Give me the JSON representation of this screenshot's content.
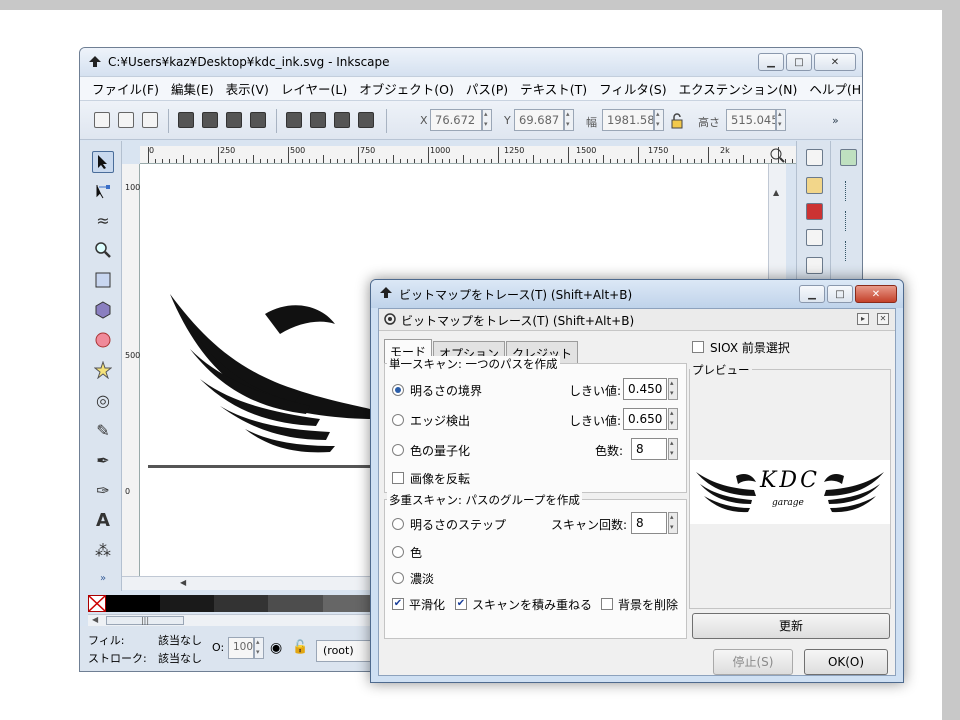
{
  "main_window": {
    "title": "C:¥Users¥kaz¥Desktop¥kdc_ink.svg - Inkscape",
    "menu": [
      "ファイル(F)",
      "編集(E)",
      "表示(V)",
      "レイヤー(L)",
      "オブジェクト(O)",
      "パス(P)",
      "テキスト(T)",
      "フィルタ(S)",
      "エクステンション(N)",
      "ヘルプ(H)"
    ],
    "coords": {
      "x_label": "X",
      "x_value": "76.672",
      "y_label": "Y",
      "y_value": "69.687",
      "w_label": "幅",
      "w_value": "1981.58",
      "h_label": "高さ",
      "h_value": "515.045"
    },
    "overflow": "»",
    "ruler_h": [
      "0",
      "250",
      "500",
      "750",
      "1000",
      "1250",
      "1500",
      "1750",
      "2k"
    ],
    "ruler_v": [
      "1000",
      "500",
      "0"
    ],
    "toolbox_more": "»",
    "status": {
      "fill_label": "フィル:",
      "fill_value": "該当なし",
      "stroke_label": "ストローク:",
      "stroke_value": "該当なし",
      "opacity_label": "O:",
      "opacity_value": "100",
      "layer": "(root)"
    }
  },
  "dialog": {
    "title": "ビットマップをトレース(T) (Shift+Alt+B)",
    "panel_title": "ビットマップをトレース(T) (Shift+Alt+B)",
    "tabs": [
      "モード",
      "オプション",
      "クレジット"
    ],
    "single_scan": {
      "title": "単一スキャン: 一つのパスを作成",
      "options": [
        {
          "label": "明るさの境界",
          "param_label": "しきい値:",
          "value": "0.450",
          "selected": true
        },
        {
          "label": "エッジ検出",
          "param_label": "しきい値:",
          "value": "0.650",
          "selected": false
        },
        {
          "label": "色の量子化",
          "param_label": "色数:",
          "value": "8",
          "selected": false
        }
      ],
      "invert_label": "画像を反転"
    },
    "multi_scan": {
      "title": "多重スキャン: パスのグループを作成",
      "options": [
        {
          "label": "明るさのステップ",
          "param_label": "スキャン回数:",
          "value": "8",
          "selected": false
        },
        {
          "label": "色",
          "selected": false
        },
        {
          "label": "濃淡",
          "selected": false
        }
      ],
      "smooth_label": "平滑化",
      "stack_label": "スキャンを積み重ねる",
      "remove_bg_label": "背景を削除"
    },
    "siox_label": "SIOX 前景選択",
    "preview_label": "プレビュー",
    "update_label": "更新",
    "stop_label": "停止(S)",
    "ok_label": "OK(O)",
    "preview_text": "KDC",
    "preview_subtext": "garage"
  },
  "palette": [
    "#000000",
    "#1a1a1a",
    "#333333",
    "#4d4d4d",
    "#666666",
    "#808080",
    "#999999",
    "#b3b3b3",
    "#cccccc",
    "#e6e6e6",
    "#f2f2f2",
    "#ffffff",
    "#800000",
    "#aa0000"
  ]
}
